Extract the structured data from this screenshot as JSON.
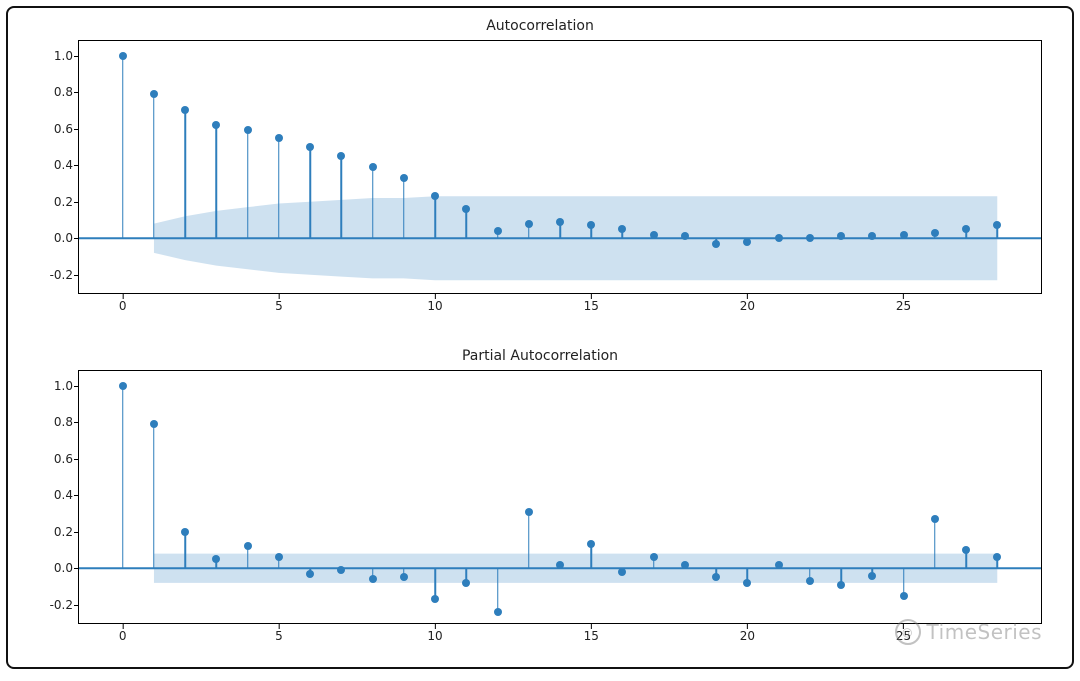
{
  "watermark": "TimeSeries",
  "chart_data": [
    {
      "type": "stem",
      "title": "Autocorrelation",
      "xlabel": "",
      "ylabel": "",
      "xlim": [
        -1.4,
        29.4
      ],
      "ylim": [
        -0.3,
        1.08
      ],
      "xticks": [
        0,
        5,
        10,
        15,
        20,
        25
      ],
      "yticks": [
        -0.2,
        0.0,
        0.2,
        0.4,
        0.6,
        0.8,
        1.0
      ],
      "x": [
        0,
        1,
        2,
        3,
        4,
        5,
        6,
        7,
        8,
        9,
        10,
        11,
        12,
        13,
        14,
        15,
        16,
        17,
        18,
        19,
        20,
        21,
        22,
        23,
        24,
        25,
        26,
        27,
        28
      ],
      "values": [
        1.0,
        0.79,
        0.7,
        0.62,
        0.59,
        0.55,
        0.5,
        0.45,
        0.39,
        0.33,
        0.23,
        0.16,
        0.04,
        0.08,
        0.09,
        0.07,
        0.05,
        0.02,
        0.01,
        -0.03,
        -0.02,
        0.0,
        0.0,
        0.01,
        0.01,
        0.02,
        0.03,
        0.05,
        0.07
      ],
      "confidence_upper": [
        0.0,
        0.08,
        0.12,
        0.15,
        0.17,
        0.19,
        0.2,
        0.21,
        0.22,
        0.22,
        0.23,
        0.23,
        0.23,
        0.23,
        0.23,
        0.23,
        0.23,
        0.23,
        0.23,
        0.23,
        0.23,
        0.23,
        0.23,
        0.23,
        0.23,
        0.23,
        0.23,
        0.23,
        0.23
      ],
      "confidence_lower": [
        0.0,
        -0.08,
        -0.12,
        -0.15,
        -0.17,
        -0.19,
        -0.2,
        -0.21,
        -0.22,
        -0.22,
        -0.23,
        -0.23,
        -0.23,
        -0.23,
        -0.23,
        -0.23,
        -0.23,
        -0.23,
        -0.23,
        -0.23,
        -0.23,
        -0.23,
        -0.23,
        -0.23,
        -0.23,
        -0.23,
        -0.23,
        -0.23,
        -0.23
      ],
      "conf_color": "#b9d4e9",
      "line_color": "#2e7ebc"
    },
    {
      "type": "stem",
      "title": "Partial Autocorrelation",
      "xlabel": "",
      "ylabel": "",
      "xlim": [
        -1.4,
        29.4
      ],
      "ylim": [
        -0.3,
        1.08
      ],
      "xticks": [
        0,
        5,
        10,
        15,
        20,
        25
      ],
      "yticks": [
        -0.2,
        0.0,
        0.2,
        0.4,
        0.6,
        0.8,
        1.0
      ],
      "x": [
        0,
        1,
        2,
        3,
        4,
        5,
        6,
        7,
        8,
        9,
        10,
        11,
        12,
        13,
        14,
        15,
        16,
        17,
        18,
        19,
        20,
        21,
        22,
        23,
        24,
        25,
        26,
        27,
        28
      ],
      "values": [
        1.0,
        0.79,
        0.2,
        0.05,
        0.12,
        0.06,
        -0.03,
        -0.01,
        -0.06,
        -0.05,
        -0.17,
        -0.08,
        -0.24,
        0.31,
        0.02,
        0.13,
        -0.02,
        0.06,
        0.02,
        -0.05,
        -0.08,
        0.02,
        -0.07,
        -0.09,
        -0.04,
        -0.15,
        0.27,
        0.1,
        0.06
      ],
      "confidence_upper": [
        0.0,
        0.08,
        0.08,
        0.08,
        0.08,
        0.08,
        0.08,
        0.08,
        0.08,
        0.08,
        0.08,
        0.08,
        0.08,
        0.08,
        0.08,
        0.08,
        0.08,
        0.08,
        0.08,
        0.08,
        0.08,
        0.08,
        0.08,
        0.08,
        0.08,
        0.08,
        0.08,
        0.08,
        0.08
      ],
      "confidence_lower": [
        0.0,
        -0.08,
        -0.08,
        -0.08,
        -0.08,
        -0.08,
        -0.08,
        -0.08,
        -0.08,
        -0.08,
        -0.08,
        -0.08,
        -0.08,
        -0.08,
        -0.08,
        -0.08,
        -0.08,
        -0.08,
        -0.08,
        -0.08,
        -0.08,
        -0.08,
        -0.08,
        -0.08,
        -0.08,
        -0.08,
        -0.08,
        -0.08,
        -0.08
      ],
      "conf_color": "#b9d4e9",
      "line_color": "#2e7ebc"
    }
  ]
}
